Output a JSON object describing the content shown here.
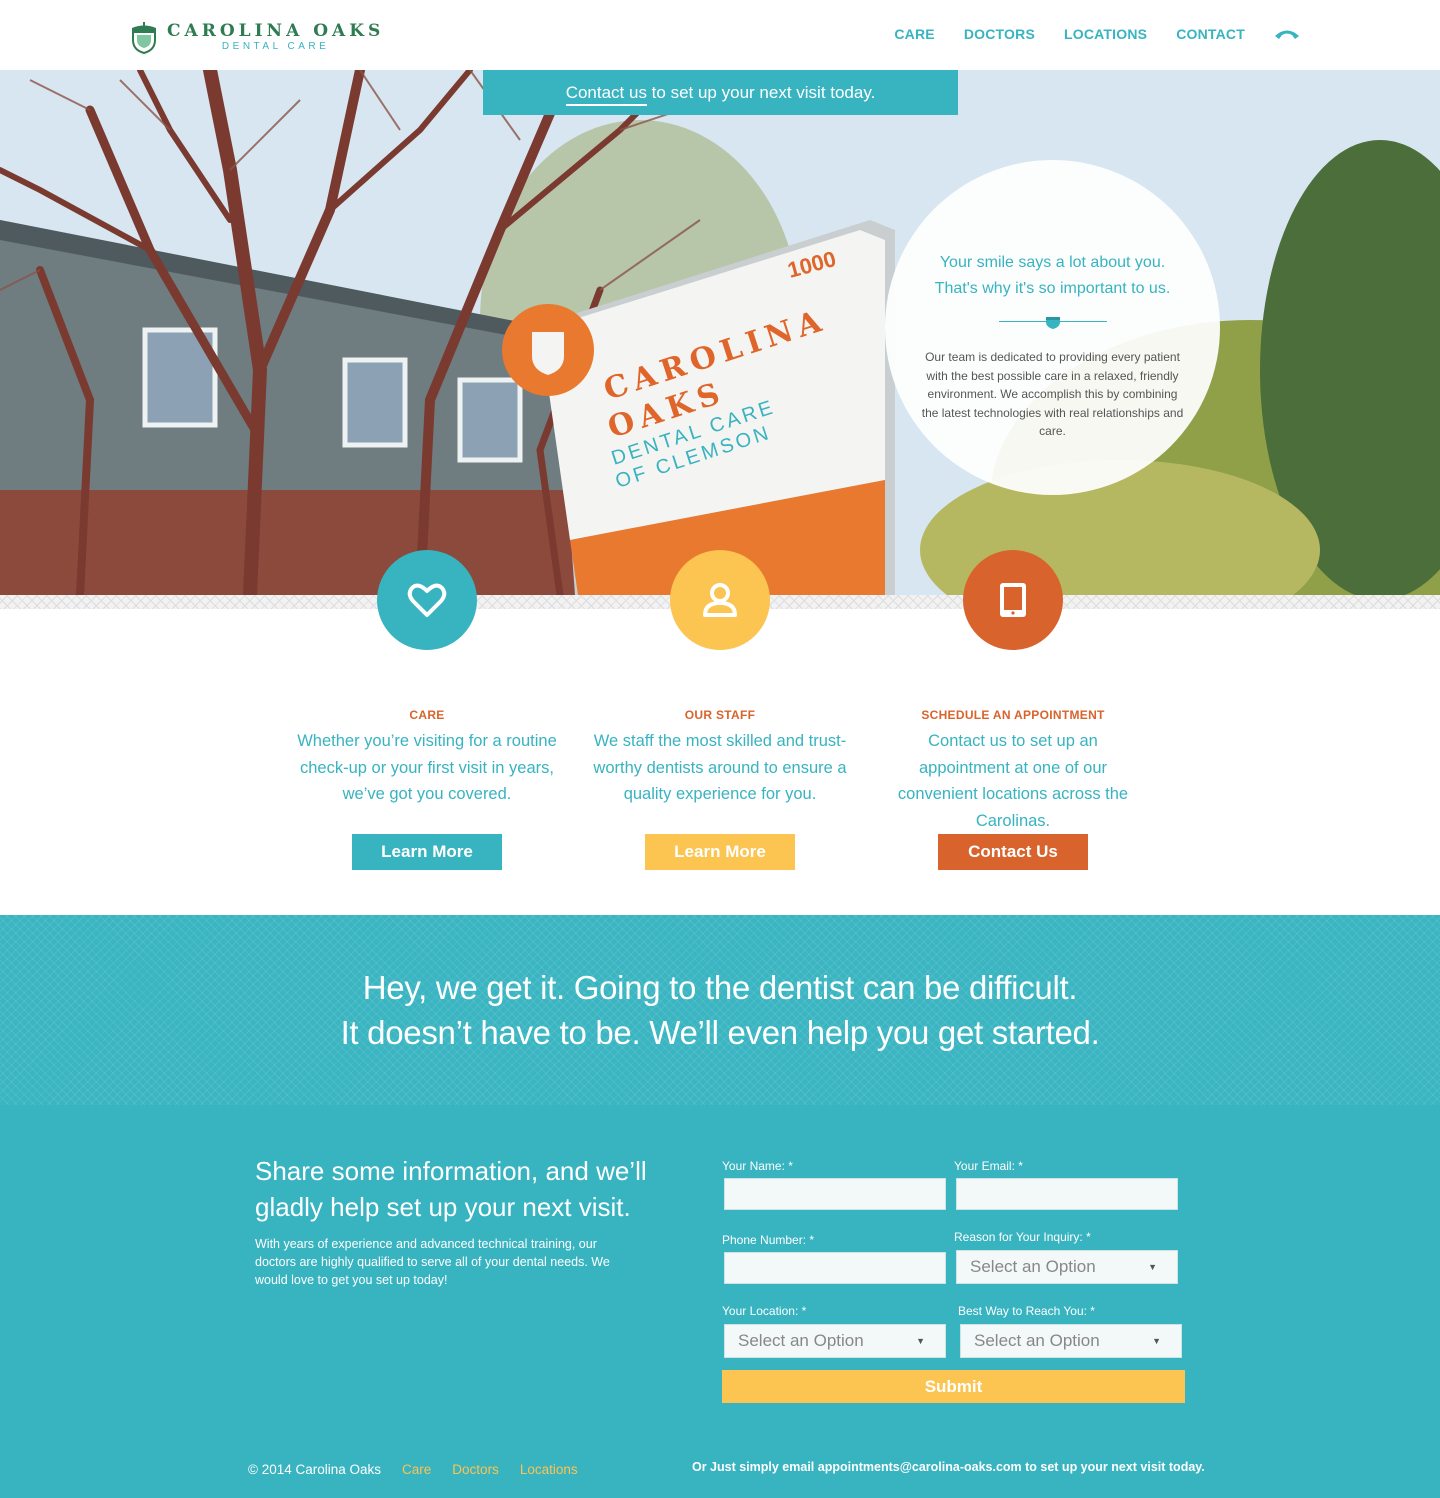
{
  "brand": {
    "name": "CAROLINA OAKS",
    "tagline": "DENTAL CARE"
  },
  "nav": {
    "items": [
      "CARE",
      "DOCTORS",
      "LOCATIONS",
      "CONTACT"
    ],
    "phone_icon": "phone-icon"
  },
  "banner": {
    "link": "Contact us",
    "text": " to set up your next visit today."
  },
  "hero": {
    "sign": {
      "number": "1000",
      "line1": "CAROLINA",
      "line2": "OAKS",
      "line3": "DENTAL CARE",
      "line4": "OF CLEMSON"
    },
    "circle": {
      "heading": "Your smile says a lot about you. That's why it's so important to us.",
      "body": "Our team is dedicated to providing every patient with the best possible care in a relaxed, friendly environment. We accomplish this by combining the latest technologies with real relationships and care."
    }
  },
  "features": [
    {
      "icon": "heart-icon",
      "title": "CARE",
      "text": "Whether you’re visiting for a routine check-up or your first visit in years, we’ve got you covered.",
      "button": "Learn More",
      "color": "#38b3c0"
    },
    {
      "icon": "user-icon",
      "title": "OUR STAFF",
      "text": "We staff the most skilled and trust-worthy dentists around to ensure a quality experience for you.",
      "button": "Learn More",
      "color": "#fcc450"
    },
    {
      "icon": "tablet-icon",
      "title": "SCHEDULE AN APPOINTMENT",
      "text": "Contact us to set up an appointment at one of our convenient locations across the Carolinas.",
      "button": "Contact Us",
      "color": "#d9632c"
    }
  ],
  "band": {
    "line1": "Hey, we get it. Going to the dentist can be difficult.",
    "line2": "It doesn’t have to be. We’ll even help you get started."
  },
  "form": {
    "title": "Share some information, and we’ll gladly help set up your next visit.",
    "body": "With years of experience and advanced technical training, our doctors are highly qualified to serve all of your dental needs. We would love to get you set up today!",
    "name_label": "Your Name: *",
    "email_label": "Your Email: *",
    "phone_label": "Phone Number: *",
    "reason_label": "Reason for Your Inquiry: *",
    "location_label": "Your Location: *",
    "reach_label": "Best Way to Reach You: *",
    "select_placeholder": "Select an Option",
    "submit": "Submit"
  },
  "footer": {
    "copyright": "© 2014 Carolina Oaks",
    "links": [
      "Care",
      "Doctors",
      "Locations"
    ],
    "note": "Or Just simply email appointments@carolina-oaks.com to set up your next visit today."
  },
  "colors": {
    "teal": "#38b3c0",
    "yellow": "#fcc450",
    "orange": "#d9632c",
    "green": "#2f7b52"
  }
}
